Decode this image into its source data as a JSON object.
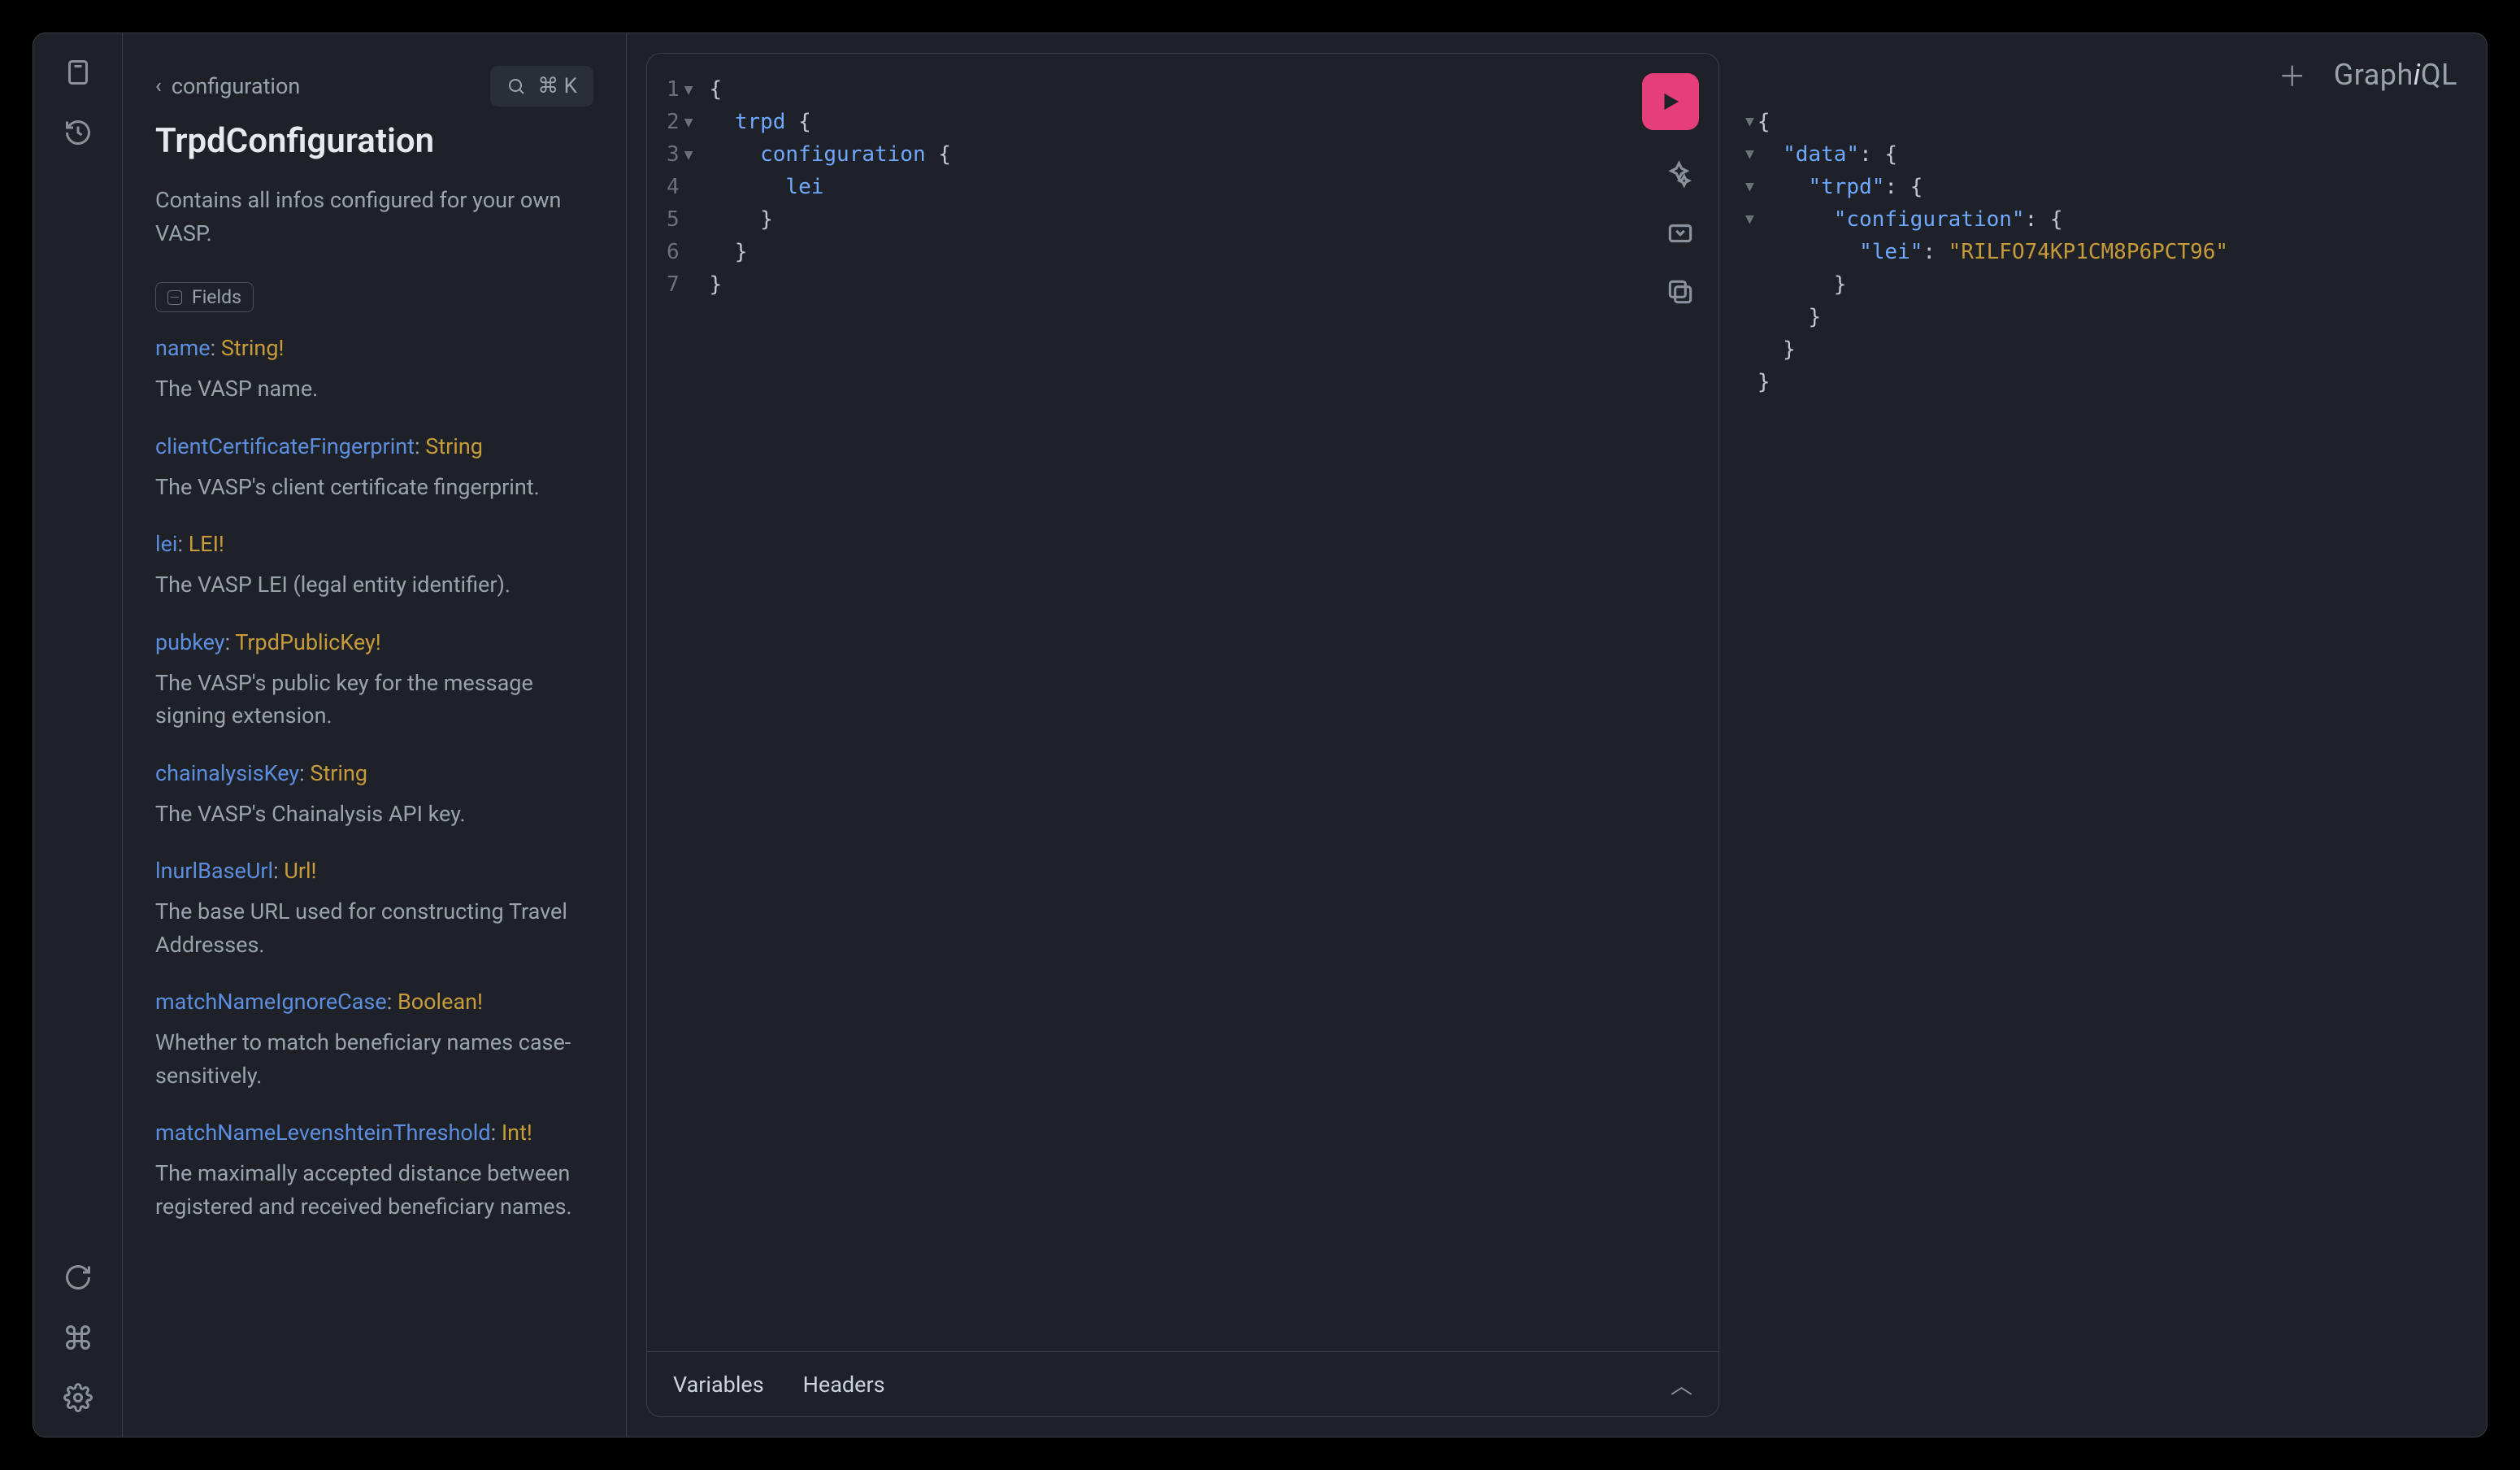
{
  "branding": {
    "logo_pre": "Graph",
    "logo_i": "i",
    "logo_post": "QL"
  },
  "search": {
    "shortcut": "⌘ K"
  },
  "docs": {
    "breadcrumb": "configuration",
    "title": "TrpdConfiguration",
    "summary": "Contains all infos configured for your own VASP.",
    "fields_label": "Fields",
    "fields": [
      {
        "name": "name",
        "type": "String!",
        "desc": "The VASP name."
      },
      {
        "name": "clientCertificateFingerprint",
        "type": "String",
        "desc": "The VASP's client certificate fingerprint."
      },
      {
        "name": "lei",
        "type": "LEI!",
        "desc": "The VASP LEI (legal entity identifier)."
      },
      {
        "name": "pubkey",
        "type": "TrpdPublicKey!",
        "desc": "The VASP's public key for the message signing extension."
      },
      {
        "name": "chainalysisKey",
        "type": "String",
        "desc": "The VASP's Chainalysis API key."
      },
      {
        "name": "lnurlBaseUrl",
        "type": "Url!",
        "desc": "The base URL used for constructing Travel Addresses."
      },
      {
        "name": "matchNameIgnoreCase",
        "type": "Boolean!",
        "desc": "Whether to match beneficiary names case-sensitively."
      },
      {
        "name": "matchNameLevenshteinThreshold",
        "type": "Int!",
        "desc": "The maximally accepted distance between registered and received beneficiary names."
      }
    ]
  },
  "query_editor": {
    "lines": [
      {
        "n": "1",
        "fold": true,
        "tokens": [
          {
            "t": "{",
            "c": "brace"
          }
        ]
      },
      {
        "n": "2",
        "fold": true,
        "tokens": [
          {
            "t": "  ",
            "c": ""
          },
          {
            "t": "trpd",
            "c": "prop"
          },
          {
            "t": " {",
            "c": "brace"
          }
        ]
      },
      {
        "n": "3",
        "fold": true,
        "tokens": [
          {
            "t": "    ",
            "c": ""
          },
          {
            "t": "configuration",
            "c": "prop"
          },
          {
            "t": " {",
            "c": "brace"
          }
        ]
      },
      {
        "n": "4",
        "fold": false,
        "tokens": [
          {
            "t": "      ",
            "c": ""
          },
          {
            "t": "lei",
            "c": "prop"
          }
        ]
      },
      {
        "n": "5",
        "fold": false,
        "tokens": [
          {
            "t": "    }",
            "c": "brace"
          }
        ]
      },
      {
        "n": "6",
        "fold": false,
        "tokens": [
          {
            "t": "  }",
            "c": "brace"
          }
        ]
      },
      {
        "n": "7",
        "fold": false,
        "tokens": [
          {
            "t": "}",
            "c": "brace"
          }
        ]
      }
    ],
    "footer_tabs": {
      "variables": "Variables",
      "headers": "Headers"
    }
  },
  "response": {
    "lines": [
      {
        "fold": true,
        "indent": 0,
        "tokens": [
          {
            "t": "{",
            "c": "punc"
          }
        ]
      },
      {
        "fold": true,
        "indent": 1,
        "tokens": [
          {
            "t": "\"data\"",
            "c": "key"
          },
          {
            "t": ": ",
            "c": "punc"
          },
          {
            "t": "{",
            "c": "punc"
          }
        ]
      },
      {
        "fold": true,
        "indent": 2,
        "tokens": [
          {
            "t": "\"trpd\"",
            "c": "key"
          },
          {
            "t": ": ",
            "c": "punc"
          },
          {
            "t": "{",
            "c": "punc"
          }
        ]
      },
      {
        "fold": true,
        "indent": 3,
        "tokens": [
          {
            "t": "\"configuration\"",
            "c": "key"
          },
          {
            "t": ": ",
            "c": "punc"
          },
          {
            "t": "{",
            "c": "punc"
          }
        ]
      },
      {
        "fold": false,
        "indent": 4,
        "tokens": [
          {
            "t": "\"lei\"",
            "c": "key"
          },
          {
            "t": ": ",
            "c": "punc"
          },
          {
            "t": "\"RILFO74KP1CM8P6PCT96\"",
            "c": "str"
          }
        ]
      },
      {
        "fold": false,
        "indent": 3,
        "tokens": [
          {
            "t": "}",
            "c": "punc"
          }
        ]
      },
      {
        "fold": false,
        "indent": 2,
        "tokens": [
          {
            "t": "}",
            "c": "punc"
          }
        ]
      },
      {
        "fold": false,
        "indent": 1,
        "tokens": [
          {
            "t": "}",
            "c": "punc"
          }
        ]
      },
      {
        "fold": false,
        "indent": 0,
        "tokens": [
          {
            "t": "}",
            "c": "punc"
          }
        ]
      }
    ]
  }
}
